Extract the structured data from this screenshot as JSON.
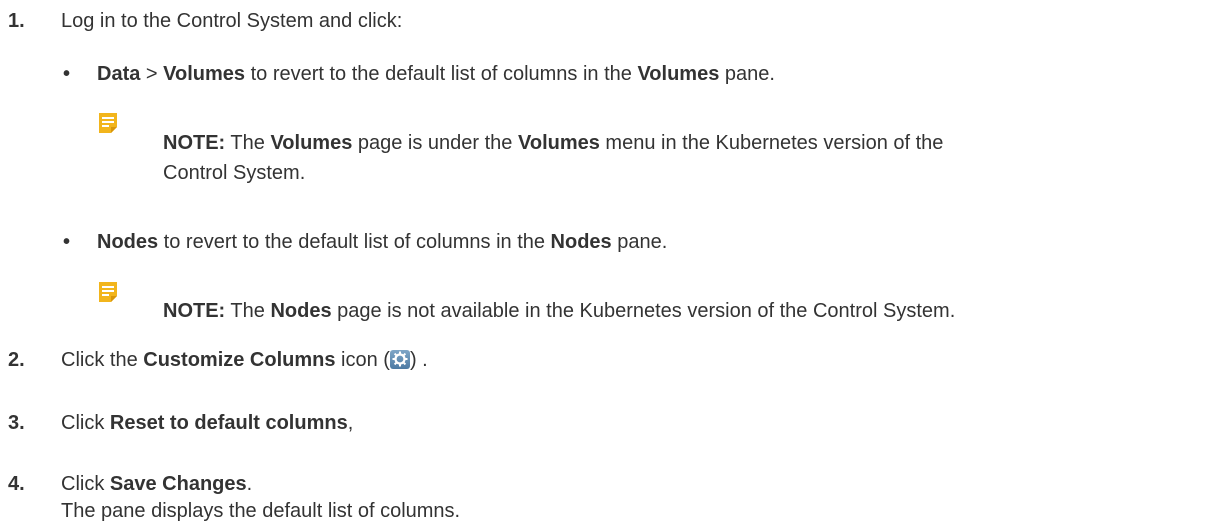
{
  "steps": [
    {
      "number": "1.",
      "text": "Log in to the Control System and click:"
    },
    {
      "number": "2.",
      "pre": "Click the ",
      "bold": "Customize Columns",
      "post1": " icon (",
      "icon": "gear-icon",
      "post2": ") ."
    },
    {
      "number": "3.",
      "pre": "Click ",
      "bold": "Reset to default columns",
      "post": ","
    },
    {
      "number": "4.",
      "pre": "Click ",
      "bold": "Save Changes",
      "post": ".",
      "result": "The pane displays the default list of columns."
    }
  ],
  "bullets": [
    {
      "bold1": "Data",
      "sep": " > ",
      "bold2": "Volumes",
      "mid": " to revert to the default list of columns in the ",
      "bold3": "Volumes",
      "end": " pane.",
      "note": {
        "label": "NOTE:",
        "t1": " The ",
        "b1": "Volumes",
        "t2": " page is under the ",
        "b2": "Volumes",
        "t3": " menu in the Kubernetes version of the",
        "line2": "Control System."
      }
    },
    {
      "bold1": "Nodes",
      "mid": " to revert to the default list of columns in the ",
      "bold3": "Nodes",
      "end": " pane.",
      "note": {
        "label": "NOTE:",
        "t1": " The ",
        "b1": "Nodes",
        "t2": " page is not available in the Kubernetes version of the Control System."
      }
    }
  ],
  "colors": {
    "text": "#333333",
    "note_icon": "#f2b51c",
    "gear_bg": "#5b88b1"
  }
}
